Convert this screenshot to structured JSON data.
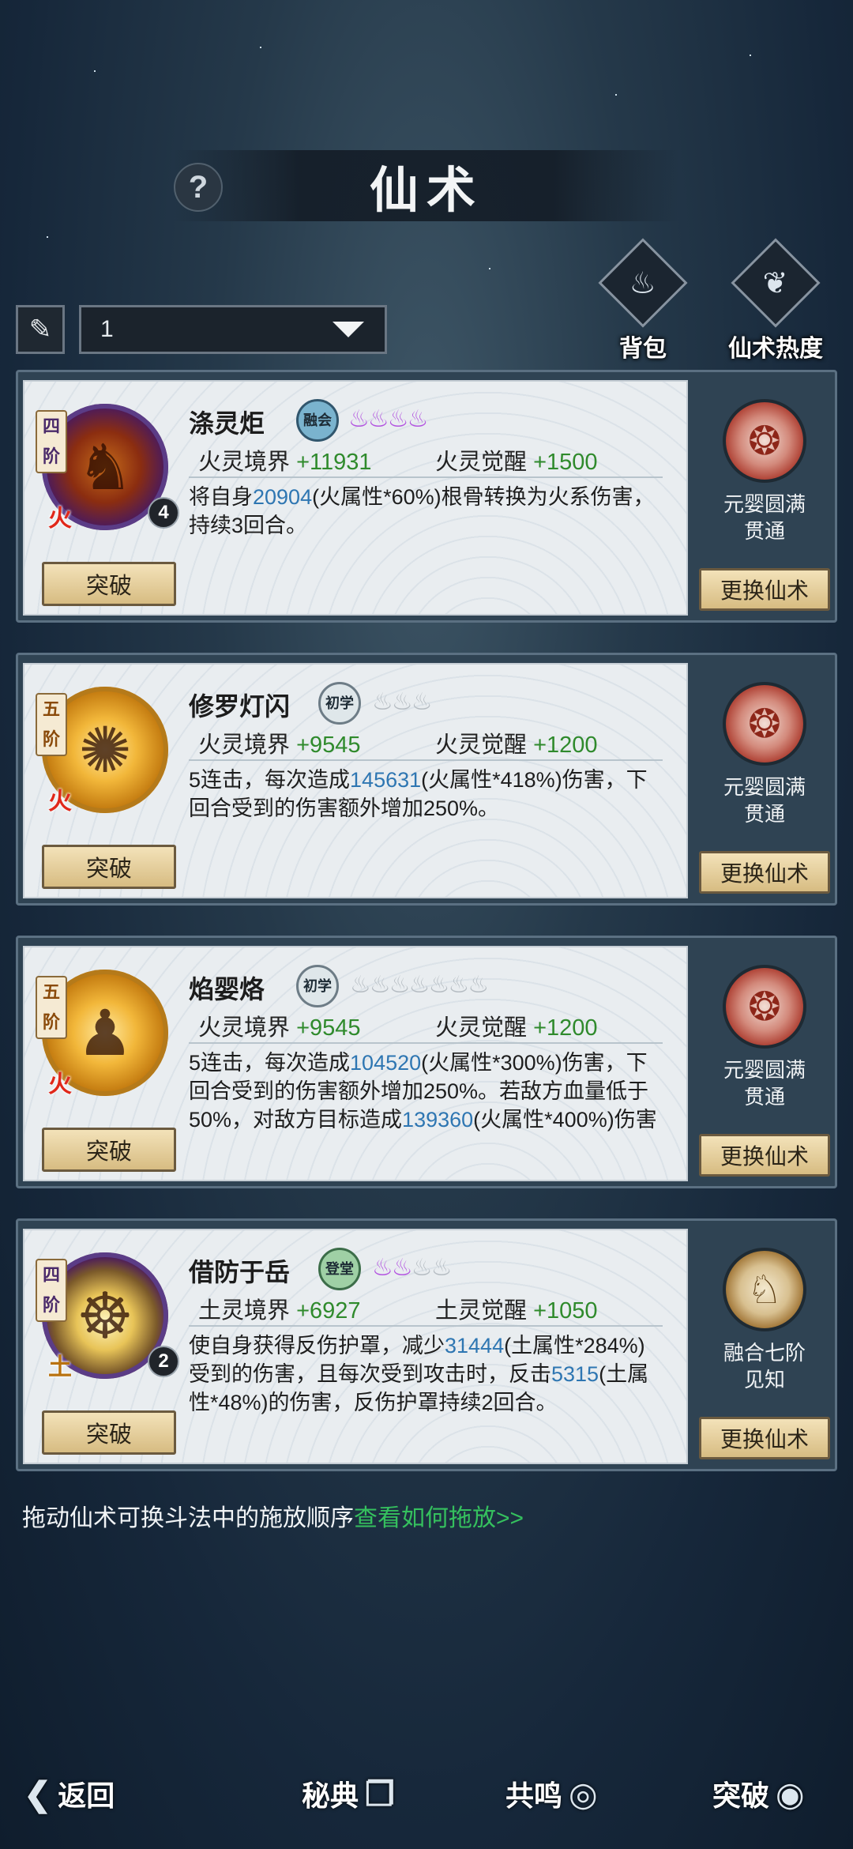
{
  "header": {
    "title": "仙术",
    "help_icon": "question-icon"
  },
  "filter": {
    "brush_icon": "brush-icon",
    "dropdown_value": "1"
  },
  "top_actions": [
    {
      "label": "背包",
      "icon": "bag-icon"
    },
    {
      "label": "仙术热度",
      "icon": "book-icon"
    }
  ],
  "stat_labels": {
    "realm_fire": "火灵境界",
    "awaken_fire": "火灵觉醒",
    "realm_earth": "土灵境界",
    "awaken_earth": "土灵觉醒"
  },
  "skills": [
    {
      "rank": "四阶",
      "element": "火",
      "level": "4",
      "name": "涤灵炬",
      "grade": "融会",
      "flames_on": 4,
      "flames_total": 4,
      "realm_value": "+11931",
      "awaken_value": "+1500",
      "desc_pre": "将自身",
      "desc_num1": "20904",
      "desc_mid1": "(火属性*60%)根骨转换为火系伤害，持续3回合。",
      "side_line1": "元婴圆满",
      "side_line2": "贯通",
      "breakthrough": "突破",
      "change": "更换仙术"
    },
    {
      "rank": "五阶",
      "element": "火",
      "level": "",
      "name": "修罗灯闪",
      "grade": "初学",
      "flames_on": 0,
      "flames_total": 3,
      "realm_value": "+9545",
      "awaken_value": "+1200",
      "desc_pre": "5连击，每次造成",
      "desc_num1": "145631",
      "desc_mid1": "(火属性*418%)伤害，下回合受到的伤害额外增加250%。",
      "side_line1": "元婴圆满",
      "side_line2": "贯通",
      "breakthrough": "突破",
      "change": "更换仙术"
    },
    {
      "rank": "五阶",
      "element": "火",
      "level": "",
      "name": "焰婴烙",
      "grade": "初学",
      "flames_on": 0,
      "flames_total": 7,
      "realm_value": "+9545",
      "awaken_value": "+1200",
      "desc_pre": "5连击，每次造成",
      "desc_num1": "104520",
      "desc_mid1": "(火属性*300%)伤害，下回合受到的伤害额外增加250%。若敌方血量低于50%，对敌方目标造成",
      "desc_num2": "139360",
      "desc_mid2": "(火属性*400%)伤害",
      "side_line1": "元婴圆满",
      "side_line2": "贯通",
      "breakthrough": "突破",
      "change": "更换仙术"
    },
    {
      "rank": "四阶",
      "element": "土",
      "level": "2",
      "name": "借防于岳",
      "grade": "登堂",
      "flames_on": 2,
      "flames_total": 4,
      "realm_value": "+6927",
      "awaken_value": "+1050",
      "desc_pre": "使自身获得反伤护罩，减少",
      "desc_num1": "31444",
      "desc_mid1": "(土属性*284%)受到的伤害，且每次受到攻击时，反击",
      "desc_num2": "5315",
      "desc_mid2": "(土属性*48%)的伤害，反伤护罩持续2回合。",
      "side_line1": "融合七阶",
      "side_line2": "见知",
      "breakthrough": "突破",
      "change": "更换仙术"
    }
  ],
  "hint": {
    "text": "拖动仙术可换斗法中的施放顺序",
    "link": "查看如何拖放>>"
  },
  "bottom_nav": [
    {
      "label": "返回",
      "icon": "back-arrow-icon"
    },
    {
      "label": "秘典",
      "icon": "open-book-icon"
    },
    {
      "label": "共鸣",
      "icon": "swirl-icon"
    },
    {
      "label": "突破",
      "icon": "spiral-icon"
    }
  ],
  "colors": {
    "value_green": "#2f8a2c",
    "number_blue": "#2e76b2",
    "link_green": "#35c05e",
    "flame_purple": "#b354e0"
  }
}
